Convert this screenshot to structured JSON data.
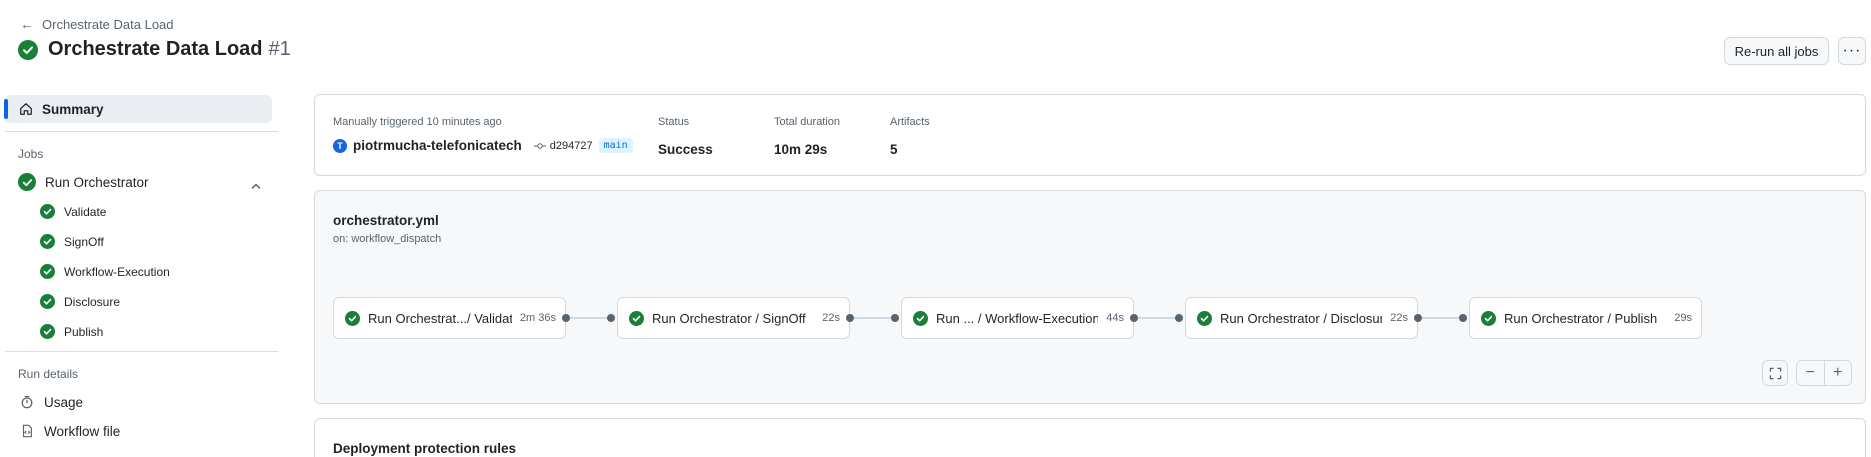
{
  "header": {
    "back_label": "Orchestrate Data Load",
    "title": "Orchestrate Data Load",
    "run_number": "#1",
    "rerun_label": "Re-run all jobs",
    "more_label": "···"
  },
  "sidebar": {
    "summary_label": "Summary",
    "jobs_heading": "Jobs",
    "job": {
      "label": "Run Orchestrator",
      "expanded": true
    },
    "steps": [
      {
        "label": "Validate"
      },
      {
        "label": "SignOff"
      },
      {
        "label": "Workflow-Execution"
      },
      {
        "label": "Disclosure"
      },
      {
        "label": "Publish"
      }
    ],
    "run_details_heading": "Run details",
    "usage_label": "Usage",
    "workflow_file_label": "Workflow file"
  },
  "summary": {
    "trigger_text": "Manually triggered 10 minutes ago",
    "actor": "piotrmucha-telefonicatech",
    "avatar_letter": "T",
    "commit": "d294727",
    "branch": "main",
    "status_label": "Status",
    "status_value": "Success",
    "duration_label": "Total duration",
    "duration_value": "10m 29s",
    "artifacts_label": "Artifacts",
    "artifacts_value": "5"
  },
  "graph": {
    "file": "orchestrator.yml",
    "trigger": "on: workflow_dispatch",
    "jobs": [
      {
        "name": "Run Orchestrat.../ Validate",
        "duration": "2m 36s"
      },
      {
        "name": "Run Orchestrator / SignOff",
        "duration": "22s"
      },
      {
        "name": "Run ...  / Workflow-Execution",
        "duration": "44s"
      },
      {
        "name": "Run Orchestrator / Disclosure",
        "duration": "22s"
      },
      {
        "name": "Run Orchestrator / Publish",
        "duration": "29s"
      }
    ],
    "zoom_out": "−",
    "zoom_in": "+"
  },
  "deployment": {
    "title": "Deployment protection rules"
  },
  "colors": {
    "success": "#1a7f37",
    "accent": "#0969da"
  }
}
